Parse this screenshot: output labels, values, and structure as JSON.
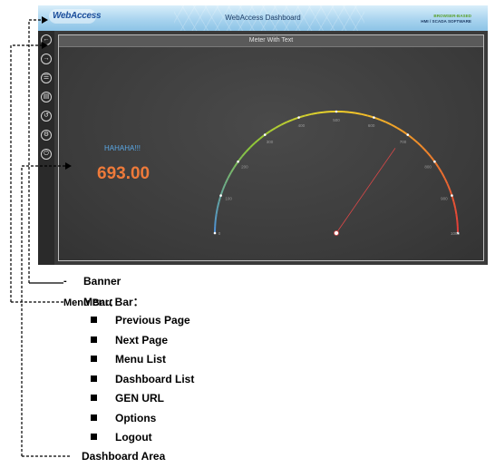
{
  "banner": {
    "logo": "WebAccess",
    "title": "WebAccess Dashboard",
    "tagline_line1": "BROWSER-BASED",
    "tagline_line2": "HMI / SCADA  SOFTWARE"
  },
  "menubar": {
    "icons": [
      "back-arrow-icon",
      "forward-arrow-icon",
      "menu-list-icon",
      "dashboard-list-icon",
      "gen-url-icon",
      "options-gear-icon",
      "logout-power-icon"
    ]
  },
  "dashboard": {
    "title": "Meter With Text",
    "label": "HAHAHA!!!",
    "value": "693.00",
    "gauge": {
      "min": 0,
      "max": 1000,
      "tick_labels": [
        "0",
        "100",
        "200",
        "300",
        "400",
        "500",
        "600",
        "700",
        "800",
        "900",
        "1000"
      ],
      "needle_value": 693,
      "colors": [
        "#4d8fd8",
        "#8cc83a",
        "#f2d22a",
        "#f08a2a",
        "#e03a3a"
      ]
    }
  },
  "annotations": {
    "banner": "Banner",
    "menubar": "Menu Bar：",
    "menu_items": [
      "Previous Page",
      "Next Page",
      "Menu List",
      "Dashboard List",
      "GEN URL",
      "Options",
      "Logout"
    ],
    "dashboard_area": "Dashboard Area",
    "dash_char": "-"
  }
}
